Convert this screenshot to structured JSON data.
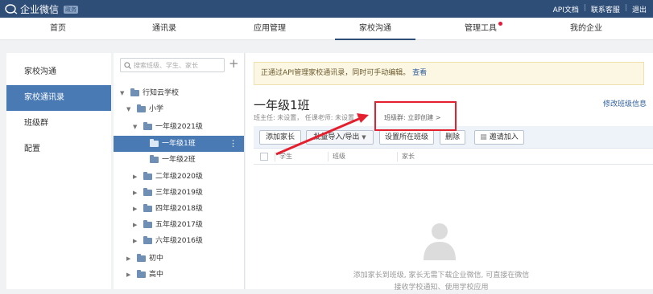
{
  "app": {
    "name": "企业微信",
    "badge": "政务",
    "links": [
      "API文档",
      "联系客服",
      "退出"
    ]
  },
  "nav": {
    "items": [
      "首页",
      "通讯录",
      "应用管理",
      "家校沟通",
      "管理工具",
      "我的企业"
    ],
    "active": "家校沟通"
  },
  "sidebar": {
    "items": [
      "家校沟通",
      "家校通讯录",
      "班级群",
      "配置"
    ],
    "active": "家校通讯录"
  },
  "tree": {
    "search_placeholder": "搜索班级、学生、家长",
    "nodes": [
      {
        "label": "行知云学校",
        "expanded": true
      },
      {
        "label": "小学",
        "expanded": true
      },
      {
        "label": "一年级2021级",
        "expanded": true
      },
      {
        "label": "一年级1班",
        "selected": true
      },
      {
        "label": "一年级2班"
      },
      {
        "label": "二年级2020级"
      },
      {
        "label": "三年级2019级"
      },
      {
        "label": "四年级2018级"
      },
      {
        "label": "五年级2017级"
      },
      {
        "label": "六年级2016级"
      },
      {
        "label": "初中"
      },
      {
        "label": "高中"
      }
    ]
  },
  "main": {
    "notice_text": "正通过API管理家校通讯录，同时可手动编辑。",
    "notice_link": "查看",
    "class_title": "一年级1班",
    "edit_link": "修改班级信息",
    "sub_info": "班主任: 未设置， 任课老师: 未设置 >",
    "group_link": "班级群: 立即创建 >",
    "toolbar": {
      "add_parent": "添加家长",
      "batch": "批量导入/导出",
      "set_class": "设置所在班级",
      "delete": "删除",
      "invite": "邀请加入"
    },
    "columns": [
      "学生",
      "班级",
      "家长"
    ],
    "empty_line1": "添加家长到班级, 家长无需下载企业微信, 可直接在微信",
    "empty_line2": "接收学校通知、使用学校应用"
  },
  "colors": {
    "topbar": "#2e4e78",
    "selected": "#4a7ab4",
    "annotation": "#e5202e"
  }
}
